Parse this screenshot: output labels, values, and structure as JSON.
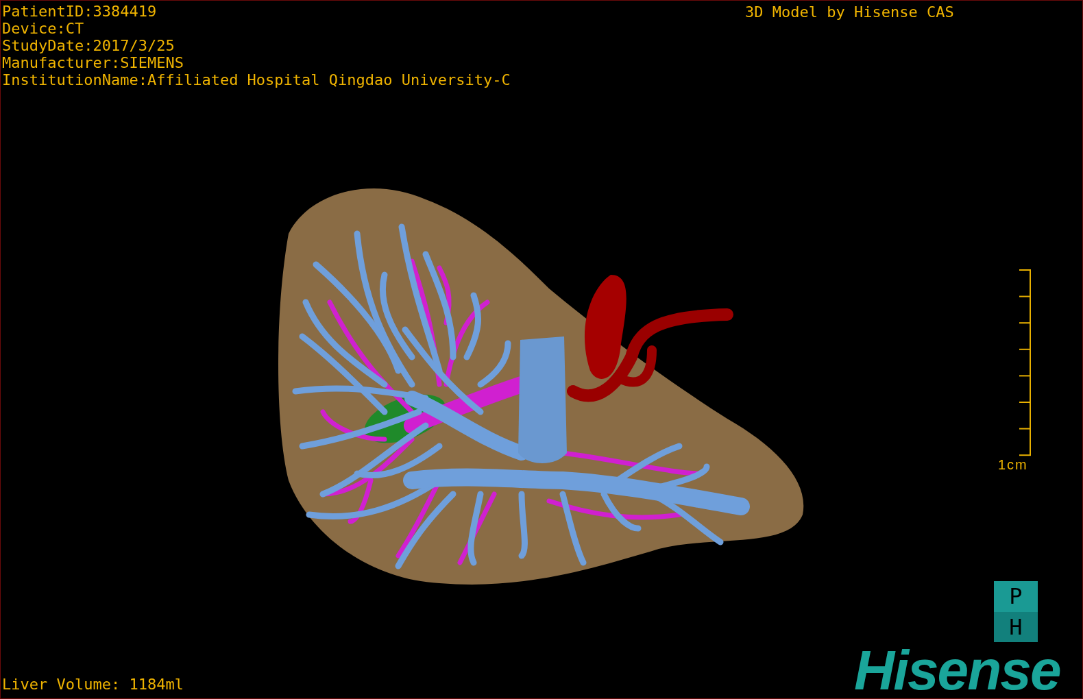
{
  "patient_info": [
    "PatientID:3384419",
    "Device:CT",
    "StudyDate:2017/3/25",
    "Manufacturer:SIEMENS",
    "InstitutionName:Affiliated Hospital Qingdao University-C"
  ],
  "title": "3D Model by Hisense CAS",
  "scale_bar": {
    "label": "1cm"
  },
  "orientation_cube": {
    "top": "P",
    "bottom": "H"
  },
  "logo": "Hisense",
  "liver_volume": "Liver Volume: 1184ml"
}
